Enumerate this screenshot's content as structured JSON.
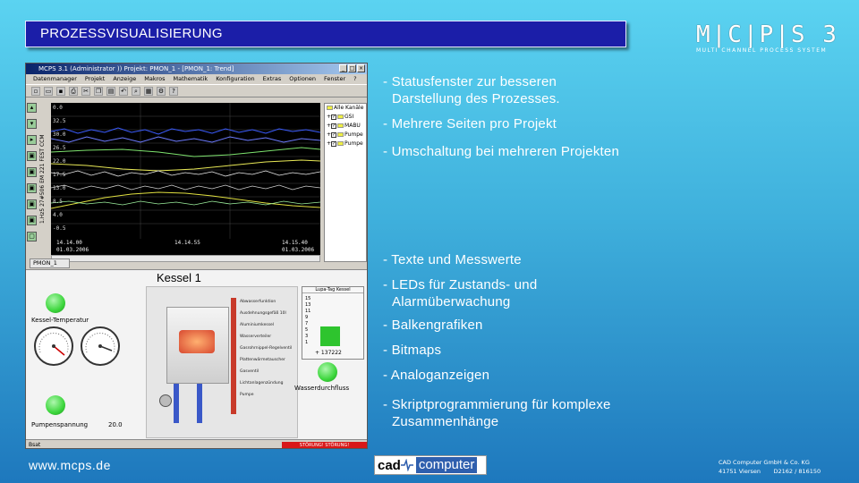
{
  "header": {
    "title": "PROZESSVISUALISIERUNG"
  },
  "logo": {
    "main": "M|C|P|S 3",
    "sub": "MULTI CHANNEL PROCESS SYSTEM"
  },
  "app": {
    "window_title": "MCPS 3.1   (Administrator ))   Projekt: PMON_1 - [PMON_1: Trend]",
    "menu": [
      "Datenmanager",
      "Projekt",
      "Anzeige",
      "Makros",
      "Mathematik",
      "Konfiguration",
      "Extras",
      "Optionen",
      "Fenster",
      "?"
    ],
    "trend_axis_label": "1.Hz5  27#506 EM  221 FEST  CCM",
    "y_ticks": [
      "0.0",
      "32.5",
      "30.0",
      "26.5",
      "22.0",
      "17.5",
      "13.0",
      "8.5",
      "4.0",
      "-0.5"
    ],
    "x_left": "14.14.00\n01.03.2006",
    "x_mid": "14.14.55",
    "x_right": "14.15.40\n01.03.2006",
    "legend": {
      "root": "Alle Kanäle",
      "items": [
        "GSI",
        "MABU",
        "Pumpe",
        "Pumpe"
      ]
    },
    "page_tab": "PMON_1",
    "panel": {
      "title": "Kessel 1",
      "kessel_temp_label": "Kessel-Temperatur",
      "pump_voltage_label": "Pumpenspannung",
      "pump_voltage_value": "20.0",
      "bar_title": "Lupa-Tag Kessel",
      "bar_ticks": [
        "15",
        "13",
        "11",
        "9",
        "7",
        "5",
        "3",
        "1"
      ],
      "bar_value": "+ 137222",
      "flow_label": "Wasserdurchfluss",
      "callouts": [
        "Abwasserfunktion",
        "Ausdehnungsgefäß 10l",
        "Aluminiumkessel",
        "Wasserverteiler",
        "Gasrohrnippel-Regelventil",
        "Plattenwärmetauscher",
        "Gasventil",
        "Lichtanlagenzündung",
        "Pumpe"
      ]
    },
    "status_left": "Bsat",
    "status_alarm": "STÖRUNG! STÖRUNG!"
  },
  "bullets": {
    "top": [
      "- Statusfenster zur besseren",
      "Darstellung des Prozesses.",
      "- Mehrere Seiten pro Projekt",
      "- Umschaltung bei mehreren Projekten"
    ],
    "bottom": [
      "- Texte und Messwerte",
      "- LEDs für Zustands- und",
      "Alarmüberwachung",
      "- Balkengrafiken",
      "- Bitmaps",
      "- Analoganzeigen",
      "- Skriptprogrammierung für komplexe",
      "Zusammenhänge"
    ]
  },
  "footer": {
    "url": "www.mcps.de",
    "cad_logo_left": "cad",
    "cad_logo_right": "computer",
    "company_line1": "CAD Computer GmbH & Co. KG",
    "company_line2": "41751 Viersen       D2162 / 816150"
  },
  "colors": {
    "title_bg": "#1b1ea8",
    "trend_bg": "#000000",
    "led_green": "#3cd63c",
    "alarm_red": "#d81818"
  }
}
